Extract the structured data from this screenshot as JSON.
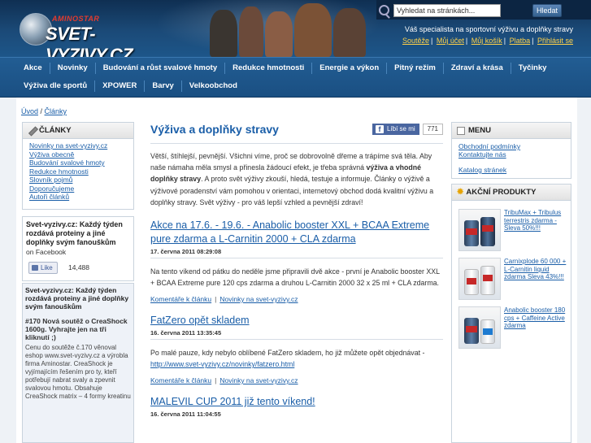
{
  "header": {
    "logo_small": "AMINOSTAR",
    "logo_text": "SVET-VYZIVY.CZ",
    "search_value": "Vyhledat na stránkách...",
    "search_button": "Hledat",
    "tagline": "Váš specialista na sportovní výživu a doplňky stravy",
    "top_links": [
      "Soutěže",
      "Můj účet",
      "Můj košík",
      "Platba",
      "Přihlásit se"
    ]
  },
  "nav": {
    "row1": [
      "Akce",
      "Novinky",
      "Budování a růst svalové hmoty",
      "Redukce hmotnosti",
      "Energie a výkon",
      "Pitný režim",
      "Zdraví a krása",
      "Tyčinky"
    ],
    "row2": [
      "Výživa dle sportů",
      "XPOWER",
      "Barvy",
      "Velkoobchod"
    ]
  },
  "breadcrumb": {
    "home": "Úvod",
    "sep": " / ",
    "current": "Články"
  },
  "left": {
    "title": "ČLÁNKY",
    "links": [
      "Novinky na svet-vyzivy.cz",
      "Výživa obecně",
      "Budování svalové hmoty",
      "Redukce hmotnosti",
      "Slovník pojmů",
      "Doporučujeme",
      "Autoři článků"
    ],
    "fb_title": "Svet-vyzivy.cz: Každý týden rozdává proteiny a jiné doplňky svým fanouškům",
    "fb_sub": "on Facebook",
    "fb_like": "Like",
    "fb_count": "14,488",
    "feed_title": "Svet-vyzivy.cz: Každý týden rozdává proteiny a jiné doplňky svým fanouškům",
    "feed_post": "#170 Nová soutěž o CreaShock 1600g. Vyhrajte jen na tři kliknutí ;)",
    "feed_text": "Cenu do soutěže č.170 věnoval eshop www.svet-vyzivy.cz a výrobla firma Aminostar. CreaShock je vyjímajícím řešením pro ty, kteří potřebují nabrat svaly a zpevnit svalovou hmotu. Obsahuje CreaShock matrix – 4 formy kreatinu"
  },
  "main": {
    "title": "Výživa a doplňky stravy",
    "share_label": "Líbí se mi",
    "share_count": "771",
    "intro_1": "Větší, štíhlejší, pevnější. Všichni víme, proč se dobrovolně dřeme a trápíme svá těla. Aby naše námaha měla smysl a přinesla žádoucí efekt, je třeba správná ",
    "intro_bold": "výživa a vhodné doplňky stravy",
    "intro_2": ". A proto svět výživy zkouší, hledá, testuje a informuje. Články o výživě a výživové poradenství vám pomohou v orientaci, internetový obchod dodá kvalitní výživu a doplňky stravy. Svět výživy - pro váš lepší vzhled a pevnější zdraví!",
    "articles": [
      {
        "title": "Akce na 17.6. - 19.6. - Anabolic booster XXL + BCAA Extreme pure zdarma a L-Carnitin 2000 + CLA zdarma",
        "date": "17. června 2011 08:29:08",
        "body": "Na tento víkend od pátku do neděle jsme připravili dvě akce - první je Anabolic booster XXL + BCAA Extreme pure 120 cps zdarma a druhou L-Carnitin 2000 32 x 25 ml + CLA zdarma.",
        "link1": "Komentáře k článku",
        "link2": "Novinky na svet-vyzivy.cz"
      },
      {
        "title": "FatZero opět skladem",
        "date": "16. června 2011 13:35:45",
        "body": "Po malé pauze, kdy nebylo oblíbené FatZero skladem, ho již můžete opět objednávat - ",
        "body_link": "http://www.svet-vyzivy.cz/novinky/fatzero.html",
        "link1": "Komentáře k článku",
        "link2": "Novinky na svet-vyzivy.cz"
      },
      {
        "title": "MALEVIL CUP 2011 již tento víkend!",
        "date": "16. června 2011 11:04:55"
      }
    ]
  },
  "right": {
    "menu_title": "MENU",
    "menu_links": [
      "Obchodní podmínky",
      "Kontaktujte nás"
    ],
    "menu_extra": "Katalog stránek",
    "promo_title": "AKČNÍ PRODUKTY",
    "products": [
      "TribuMax + Tribulus terrestris zdarma - Sleva 50%!!!",
      "Carnixplode 60 000 + L-Carnitin liquid zdarma Sleva 43%!!!",
      "Anabolic booster 180 cps + Caffeine Active zdarma"
    ]
  },
  "colors": {
    "header": "#1b4a78",
    "nav": "#225d93",
    "link": "#1a5ea8",
    "accent_link": "#ffd24a"
  }
}
